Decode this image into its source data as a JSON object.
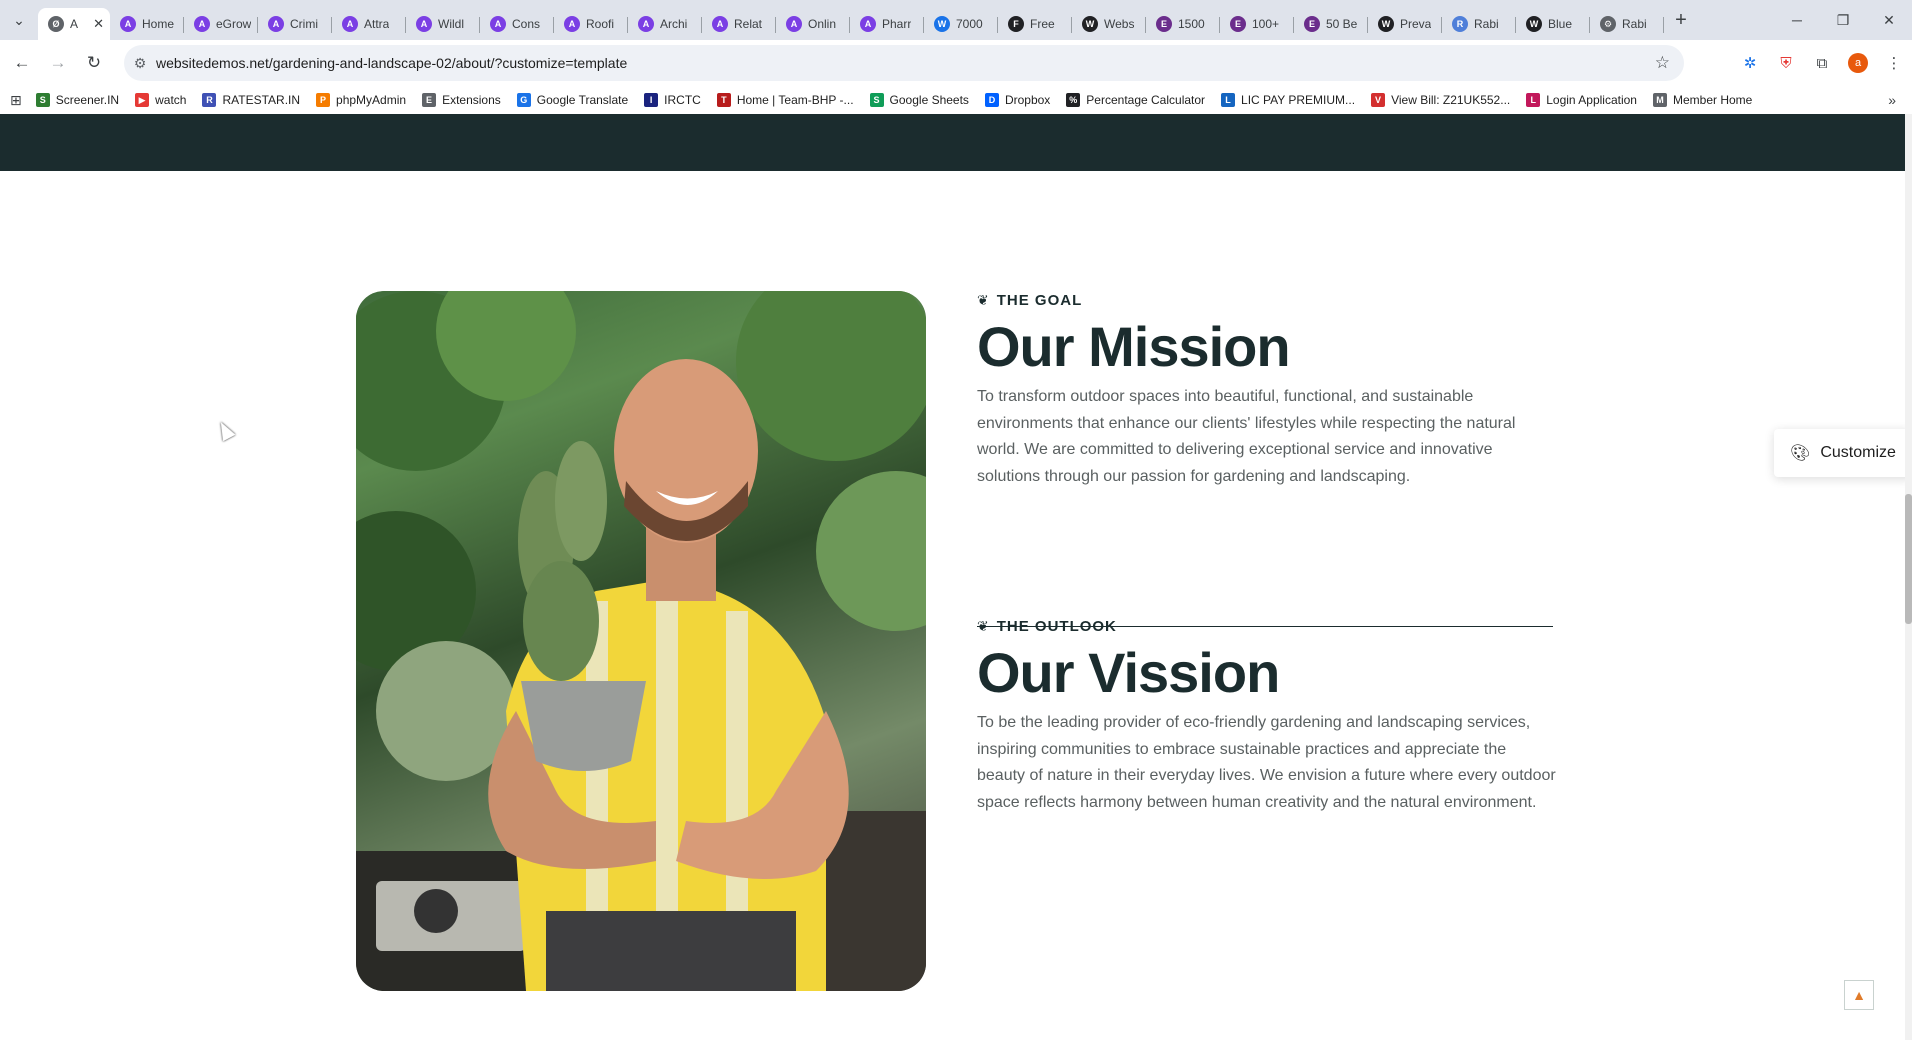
{
  "tabs": [
    {
      "title": "A",
      "color": "#5f6368",
      "letter": "Ø",
      "active": true
    },
    {
      "title": "Home",
      "color": "#7b3fe4",
      "letter": "A"
    },
    {
      "title": "eGrow",
      "color": "#7b3fe4",
      "letter": "A"
    },
    {
      "title": "Crimi",
      "color": "#7b3fe4",
      "letter": "A"
    },
    {
      "title": "Attra",
      "color": "#7b3fe4",
      "letter": "A"
    },
    {
      "title": "Wildl",
      "color": "#7b3fe4",
      "letter": "A"
    },
    {
      "title": "Cons",
      "color": "#7b3fe4",
      "letter": "A"
    },
    {
      "title": "Roofi",
      "color": "#7b3fe4",
      "letter": "A"
    },
    {
      "title": "Archi",
      "color": "#7b3fe4",
      "letter": "A"
    },
    {
      "title": "Relat",
      "color": "#7b3fe4",
      "letter": "A"
    },
    {
      "title": "Onlin",
      "color": "#7b3fe4",
      "letter": "A"
    },
    {
      "title": "Pharr",
      "color": "#7b3fe4",
      "letter": "A"
    },
    {
      "title": "7000",
      "color": "#1a73e8",
      "letter": "W"
    },
    {
      "title": "Free",
      "color": "#202124",
      "letter": "F"
    },
    {
      "title": "Webs",
      "color": "#202124",
      "letter": "W"
    },
    {
      "title": "1500",
      "color": "#6b2d8c",
      "letter": "E"
    },
    {
      "title": "100+",
      "color": "#6b2d8c",
      "letter": "E"
    },
    {
      "title": "50 Be",
      "color": "#6b2d8c",
      "letter": "E"
    },
    {
      "title": "Preva",
      "color": "#202124",
      "letter": "W"
    },
    {
      "title": "Rabi",
      "color": "#4f7fd9",
      "letter": "R"
    },
    {
      "title": "Blue",
      "color": "#202124",
      "letter": "W"
    },
    {
      "title": "Rabi",
      "color": "#5f6368",
      "letter": "⚙"
    }
  ],
  "toolbar": {
    "url": "websitedemos.net/gardening-and-landscape-02/about/?customize=template",
    "profile_letter": "a"
  },
  "bookmarks": [
    {
      "label": "Screener.IN",
      "color": "#2e7d32",
      "letter": "S"
    },
    {
      "label": "watch",
      "color": "#e53935",
      "letter": "▶"
    },
    {
      "label": "RATESTAR.IN",
      "color": "#3f51b5",
      "letter": "R"
    },
    {
      "label": "phpMyAdmin",
      "color": "#f57c00",
      "letter": "P"
    },
    {
      "label": "Extensions",
      "color": "#5f6368",
      "letter": "E"
    },
    {
      "label": "Google Translate",
      "color": "#1a73e8",
      "letter": "G"
    },
    {
      "label": "IRCTC",
      "color": "#1a237e",
      "letter": "I"
    },
    {
      "label": "Home | Team-BHP -...",
      "color": "#b71c1c",
      "letter": "T"
    },
    {
      "label": "Google Sheets",
      "color": "#0f9d58",
      "letter": "S"
    },
    {
      "label": "Dropbox",
      "color": "#0061ff",
      "letter": "D"
    },
    {
      "label": "Percentage Calculator",
      "color": "#202124",
      "letter": "%"
    },
    {
      "label": "LIC PAY PREMIUM...",
      "color": "#1565c0",
      "letter": "L"
    },
    {
      "label": "View Bill: Z21UK552...",
      "color": "#d32f2f",
      "letter": "V"
    },
    {
      "label": "Login Application",
      "color": "#c2185b",
      "letter": "L"
    },
    {
      "label": "Member Home",
      "color": "#5f6368",
      "letter": "M"
    }
  ],
  "page": {
    "goal_kicker": "THE GOAL",
    "mission_heading": "Our Mission",
    "mission_text": "To transform outdoor spaces into beautiful, functional, and sustainable environments that enhance our clients' lifestyles while respecting the natural world. We are committed to delivering exceptional service and innovative solutions through our passion for gardening and landscaping.",
    "outlook_kicker": "THE OUTLOOK",
    "vision_heading": "Our Vission",
    "vision_text": "To be the leading provider of eco-friendly gardening and landscaping services, inspiring communities to embrace sustainable practices and appreciate the beauty of nature in their everyday lives. We envision a future where every outdoor space reflects harmony between human creativity and the natural environment.",
    "customize_label": "Customize"
  }
}
